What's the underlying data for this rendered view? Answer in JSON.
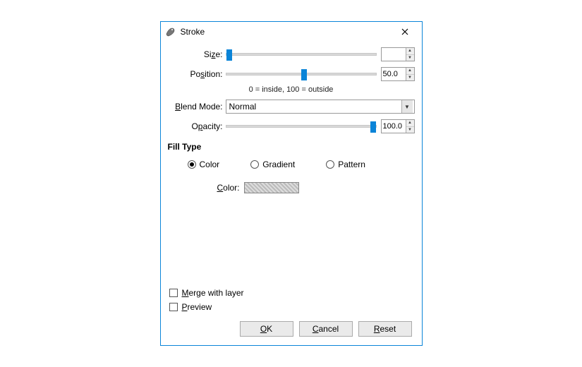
{
  "title": "Stroke",
  "labels": {
    "size": "Size:",
    "position": "Position:",
    "blend_mode": "Blend Mode:",
    "opacity": "Opacity:",
    "color": "Color:"
  },
  "hint": "0 = inside, 100 = outside",
  "values": {
    "size": "",
    "position": "50.0",
    "opacity": "100.0",
    "blend_mode": "Normal"
  },
  "slider_positions": {
    "size_pct": 0,
    "position_pct": 50,
    "opacity_pct": 100
  },
  "section_fill": "Fill Type",
  "fill_options": {
    "color": "Color",
    "gradient": "Gradient",
    "pattern": "Pattern",
    "selected": "color"
  },
  "checkboxes": {
    "merge": "Merge with layer",
    "preview": "Preview"
  },
  "buttons": {
    "ok": "OK",
    "cancel": "Cancel",
    "reset": "Reset"
  }
}
